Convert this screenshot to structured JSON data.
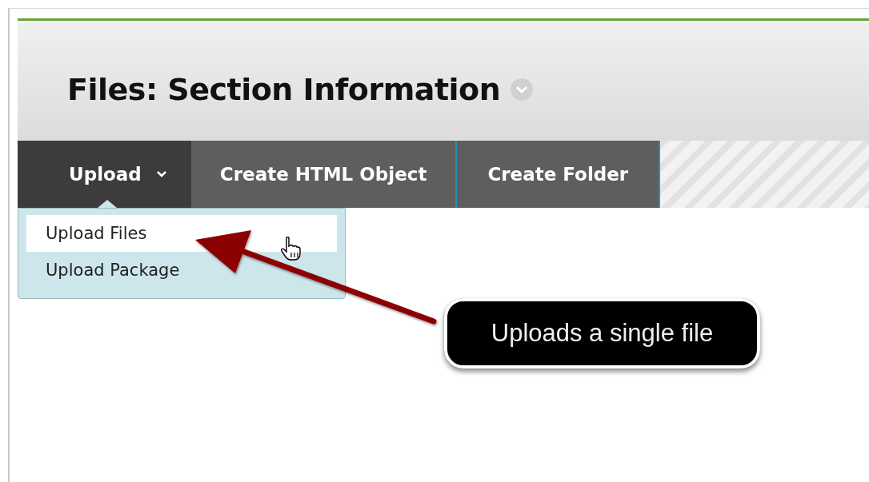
{
  "page": {
    "title": "Files: Section Information"
  },
  "toolbar": [
    {
      "label": "Upload",
      "kind": "menu",
      "selected": true
    },
    {
      "label": "Create HTML Object",
      "kind": "button",
      "selected": false
    },
    {
      "label": "Create Folder",
      "kind": "button",
      "selected": false
    }
  ],
  "dropdown": [
    {
      "label": "Upload Files",
      "selected": true
    },
    {
      "label": "Upload Package",
      "selected": false
    }
  ],
  "callout": {
    "text": "Uploads a single file"
  }
}
